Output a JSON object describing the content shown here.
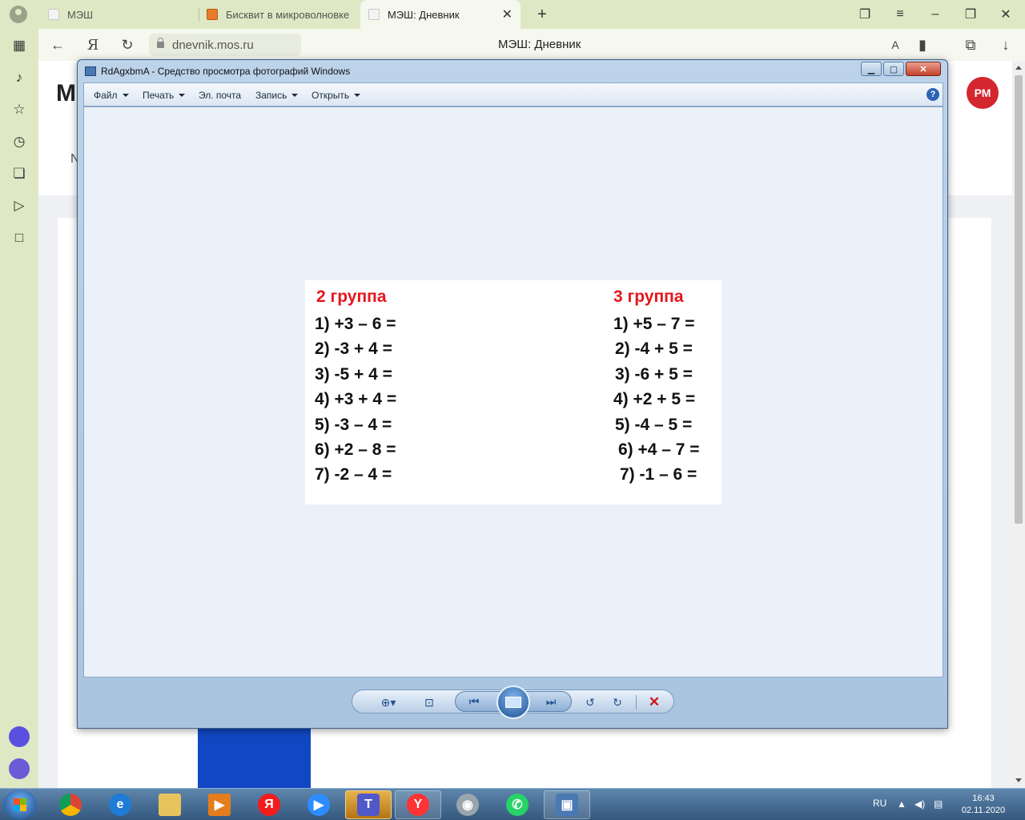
{
  "browser": {
    "tabs": [
      {
        "label": "МЭШ"
      },
      {
        "label": "Бисквит в микроволновке"
      },
      {
        "label": "МЭШ: Дневник"
      }
    ],
    "url": "dnevnik.mos.ru",
    "page_title": "МЭШ: Дневник"
  },
  "webpage": {
    "logo": "M",
    "nav_partial": "N",
    "avatar_initials": "РМ"
  },
  "viewer": {
    "title": "RdAgxbmA - Средство просмотра фотографий Windows",
    "menu": [
      {
        "label": "Файл"
      },
      {
        "label": "Печать"
      },
      {
        "label": "Эл. почта"
      },
      {
        "label": "Запись"
      },
      {
        "label": "Открыть"
      }
    ],
    "help": "?",
    "worksheet": {
      "group2": {
        "heading": "2 группа",
        "rows": [
          "1) +3 – 6 =",
          "2) -3 + 4 =",
          "3) -5 + 4 =",
          "4) +3 + 4 =",
          "5) -3 – 4 =",
          "6) +2 – 8 =",
          "7) -2 – 4 ="
        ]
      },
      "group3": {
        "heading": "3 группа",
        "rows": [
          "1) +5 – 7 =",
          "2) -4 + 5 =",
          "3) -6 + 5 =",
          "4) +2 + 5 =",
          "5) -4 – 5 =",
          "6) +4 – 7 =",
          "7) -1 – 6 ="
        ]
      }
    }
  },
  "taskbar": {
    "language": "RU",
    "time": "16:43",
    "date": "02.11.2020"
  },
  "colors": {
    "heading_red": "#e4161d",
    "avatar_red": "#d3262f",
    "taskbar_active": "#e7b34d"
  }
}
